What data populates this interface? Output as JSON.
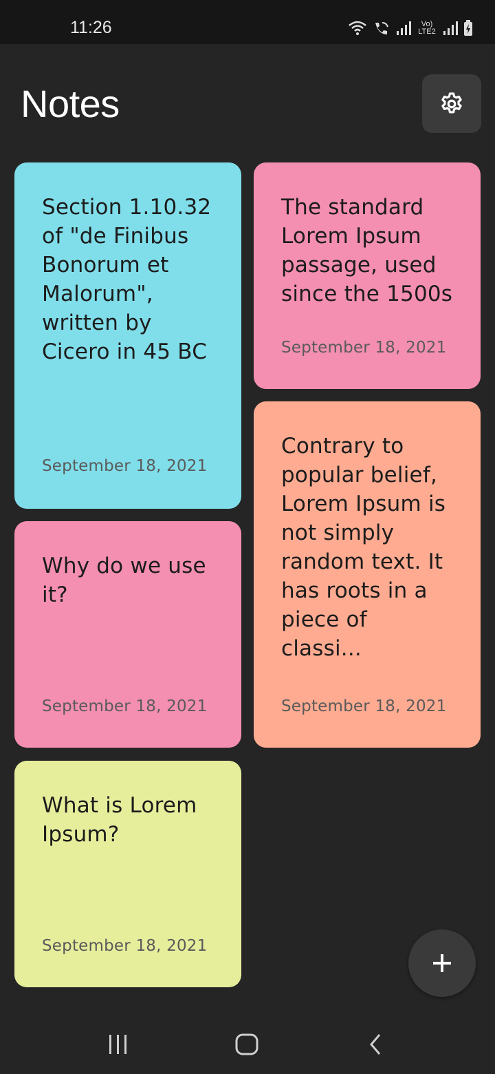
{
  "status_bar": {
    "time": "11:26",
    "network_label": "Vo) LTE2",
    "icons": [
      "wifi-icon",
      "wifi-call-icon",
      "signal-icon",
      "signal-icon",
      "battery-charging-icon"
    ]
  },
  "header": {
    "title": "Notes",
    "settings_icon": "gear-icon"
  },
  "notes": [
    {
      "text": "Section 1.10.32 of \"de Finibus Bonorum et Malorum\", written by Cicero in 45 BC",
      "date": "September 18, 2021",
      "color": "#80deea"
    },
    {
      "text": "The standard Lorem Ipsum passage, used since the 1500s",
      "date": "September 18, 2021",
      "color": "#f48fb1"
    },
    {
      "text": "Why do we use it?",
      "date": "September 18, 2021",
      "color": "#f48fb1"
    },
    {
      "text": "Contrary to popular belief, Lorem Ipsum is not simply random text. It has roots in a piece of classi...",
      "date": "September 18, 2021",
      "color": "#ffab91"
    },
    {
      "text": "What is Lorem Ipsum?",
      "date": "September 18, 2021",
      "color": "#e6ee9c"
    }
  ],
  "fab": {
    "icon": "plus-icon"
  },
  "nav_bar": {
    "icons": [
      "recents-icon",
      "home-icon",
      "back-icon"
    ]
  },
  "colors": {
    "background": "#252525",
    "status_bar": "#161616",
    "button_bg": "#3b3b3b"
  }
}
